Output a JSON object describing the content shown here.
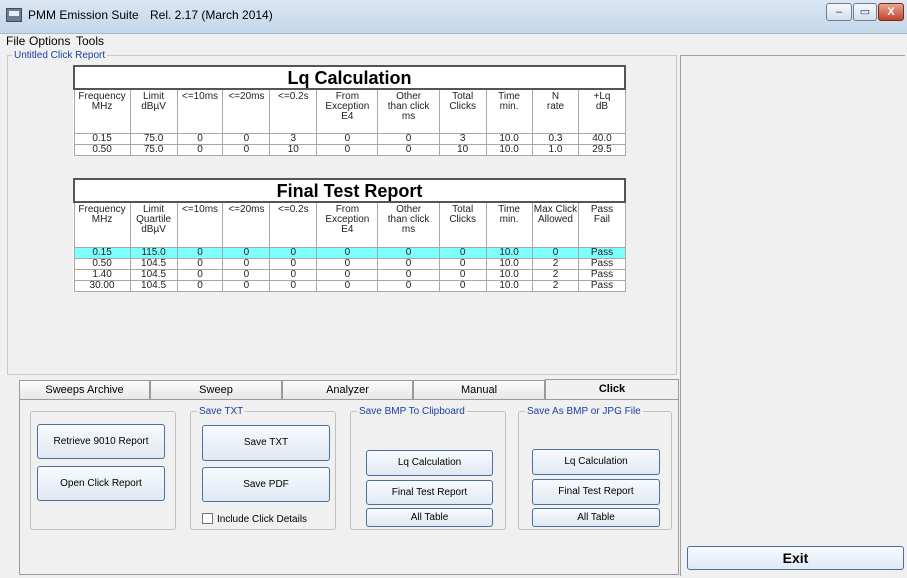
{
  "window": {
    "app_title": "PMM Emission Suite",
    "release": "Rel. 2.17 (March 2014)",
    "controls": {
      "minimize": "–",
      "maximize": "▭",
      "close": "X"
    }
  },
  "menu": [
    "File",
    "Options",
    "Tools"
  ],
  "report_group": {
    "label": "Untitled Click Report"
  },
  "lq_table": {
    "title": "Lq Calculation",
    "headers": [
      "Frequency\nMHz",
      "Limit\ndBµV",
      "<=10ms",
      "<=20ms",
      "<=0.2s",
      "From\nException\nE4",
      "Other\nthan click\nms",
      "Total\nClicks",
      "Time\nmin.",
      "N\nrate",
      "+Lq\ndB"
    ],
    "rows": [
      [
        "0.15",
        "75.0",
        "0",
        "0",
        "3",
        "0",
        "0",
        "3",
        "10.0",
        "0.3",
        "40.0"
      ],
      [
        "0.50",
        "75.0",
        "0",
        "0",
        "10",
        "0",
        "0",
        "10",
        "10.0",
        "1.0",
        "29.5"
      ]
    ]
  },
  "final_table": {
    "title": "Final Test Report",
    "headers": [
      "Frequency\nMHz",
      "Limit\nQuartile\ndBµV",
      "<=10ms",
      "<=20ms",
      "<=0.2s",
      "From\nException\nE4",
      "Other\nthan click\nms",
      "Total\nClicks",
      "Time\nmin.",
      "Max Click\nAllowed",
      "Pass\nFail"
    ],
    "rows": [
      [
        "0.15",
        "115.0",
        "0",
        "0",
        "0",
        "0",
        "0",
        "0",
        "10.0",
        "0",
        "Pass"
      ],
      [
        "0.50",
        "104.5",
        "0",
        "0",
        "0",
        "0",
        "0",
        "0",
        "10.0",
        "2",
        "Pass"
      ],
      [
        "1.40",
        "104.5",
        "0",
        "0",
        "0",
        "0",
        "0",
        "0",
        "10.0",
        "2",
        "Pass"
      ],
      [
        "30.00",
        "104.5",
        "0",
        "0",
        "0",
        "0",
        "0",
        "0",
        "10.0",
        "2",
        "Pass"
      ]
    ],
    "selected_row": 0
  },
  "tabs": [
    "Sweeps Archive",
    "Sweep",
    "Analyzer",
    "Manual",
    "Click"
  ],
  "active_tab": "Click",
  "click_panel": {
    "retrieve_button": "Retrieve 9010 Report",
    "open_button": "Open Click Report",
    "save_txt_group": "Save TXT",
    "save_txt_button": "Save TXT",
    "save_pdf_button": "Save PDF",
    "include_details": "Include Click Details",
    "clipboard_group": "Save BMP To Clipboard",
    "file_group": "Save As BMP or JPG File",
    "lq_button": "Lq Calculation",
    "final_button": "Final Test Report",
    "all_button": "All Table"
  },
  "exit_button": "Exit",
  "colors": {
    "selected_row": "#80ffff",
    "group_label": "#1a3fa0"
  }
}
